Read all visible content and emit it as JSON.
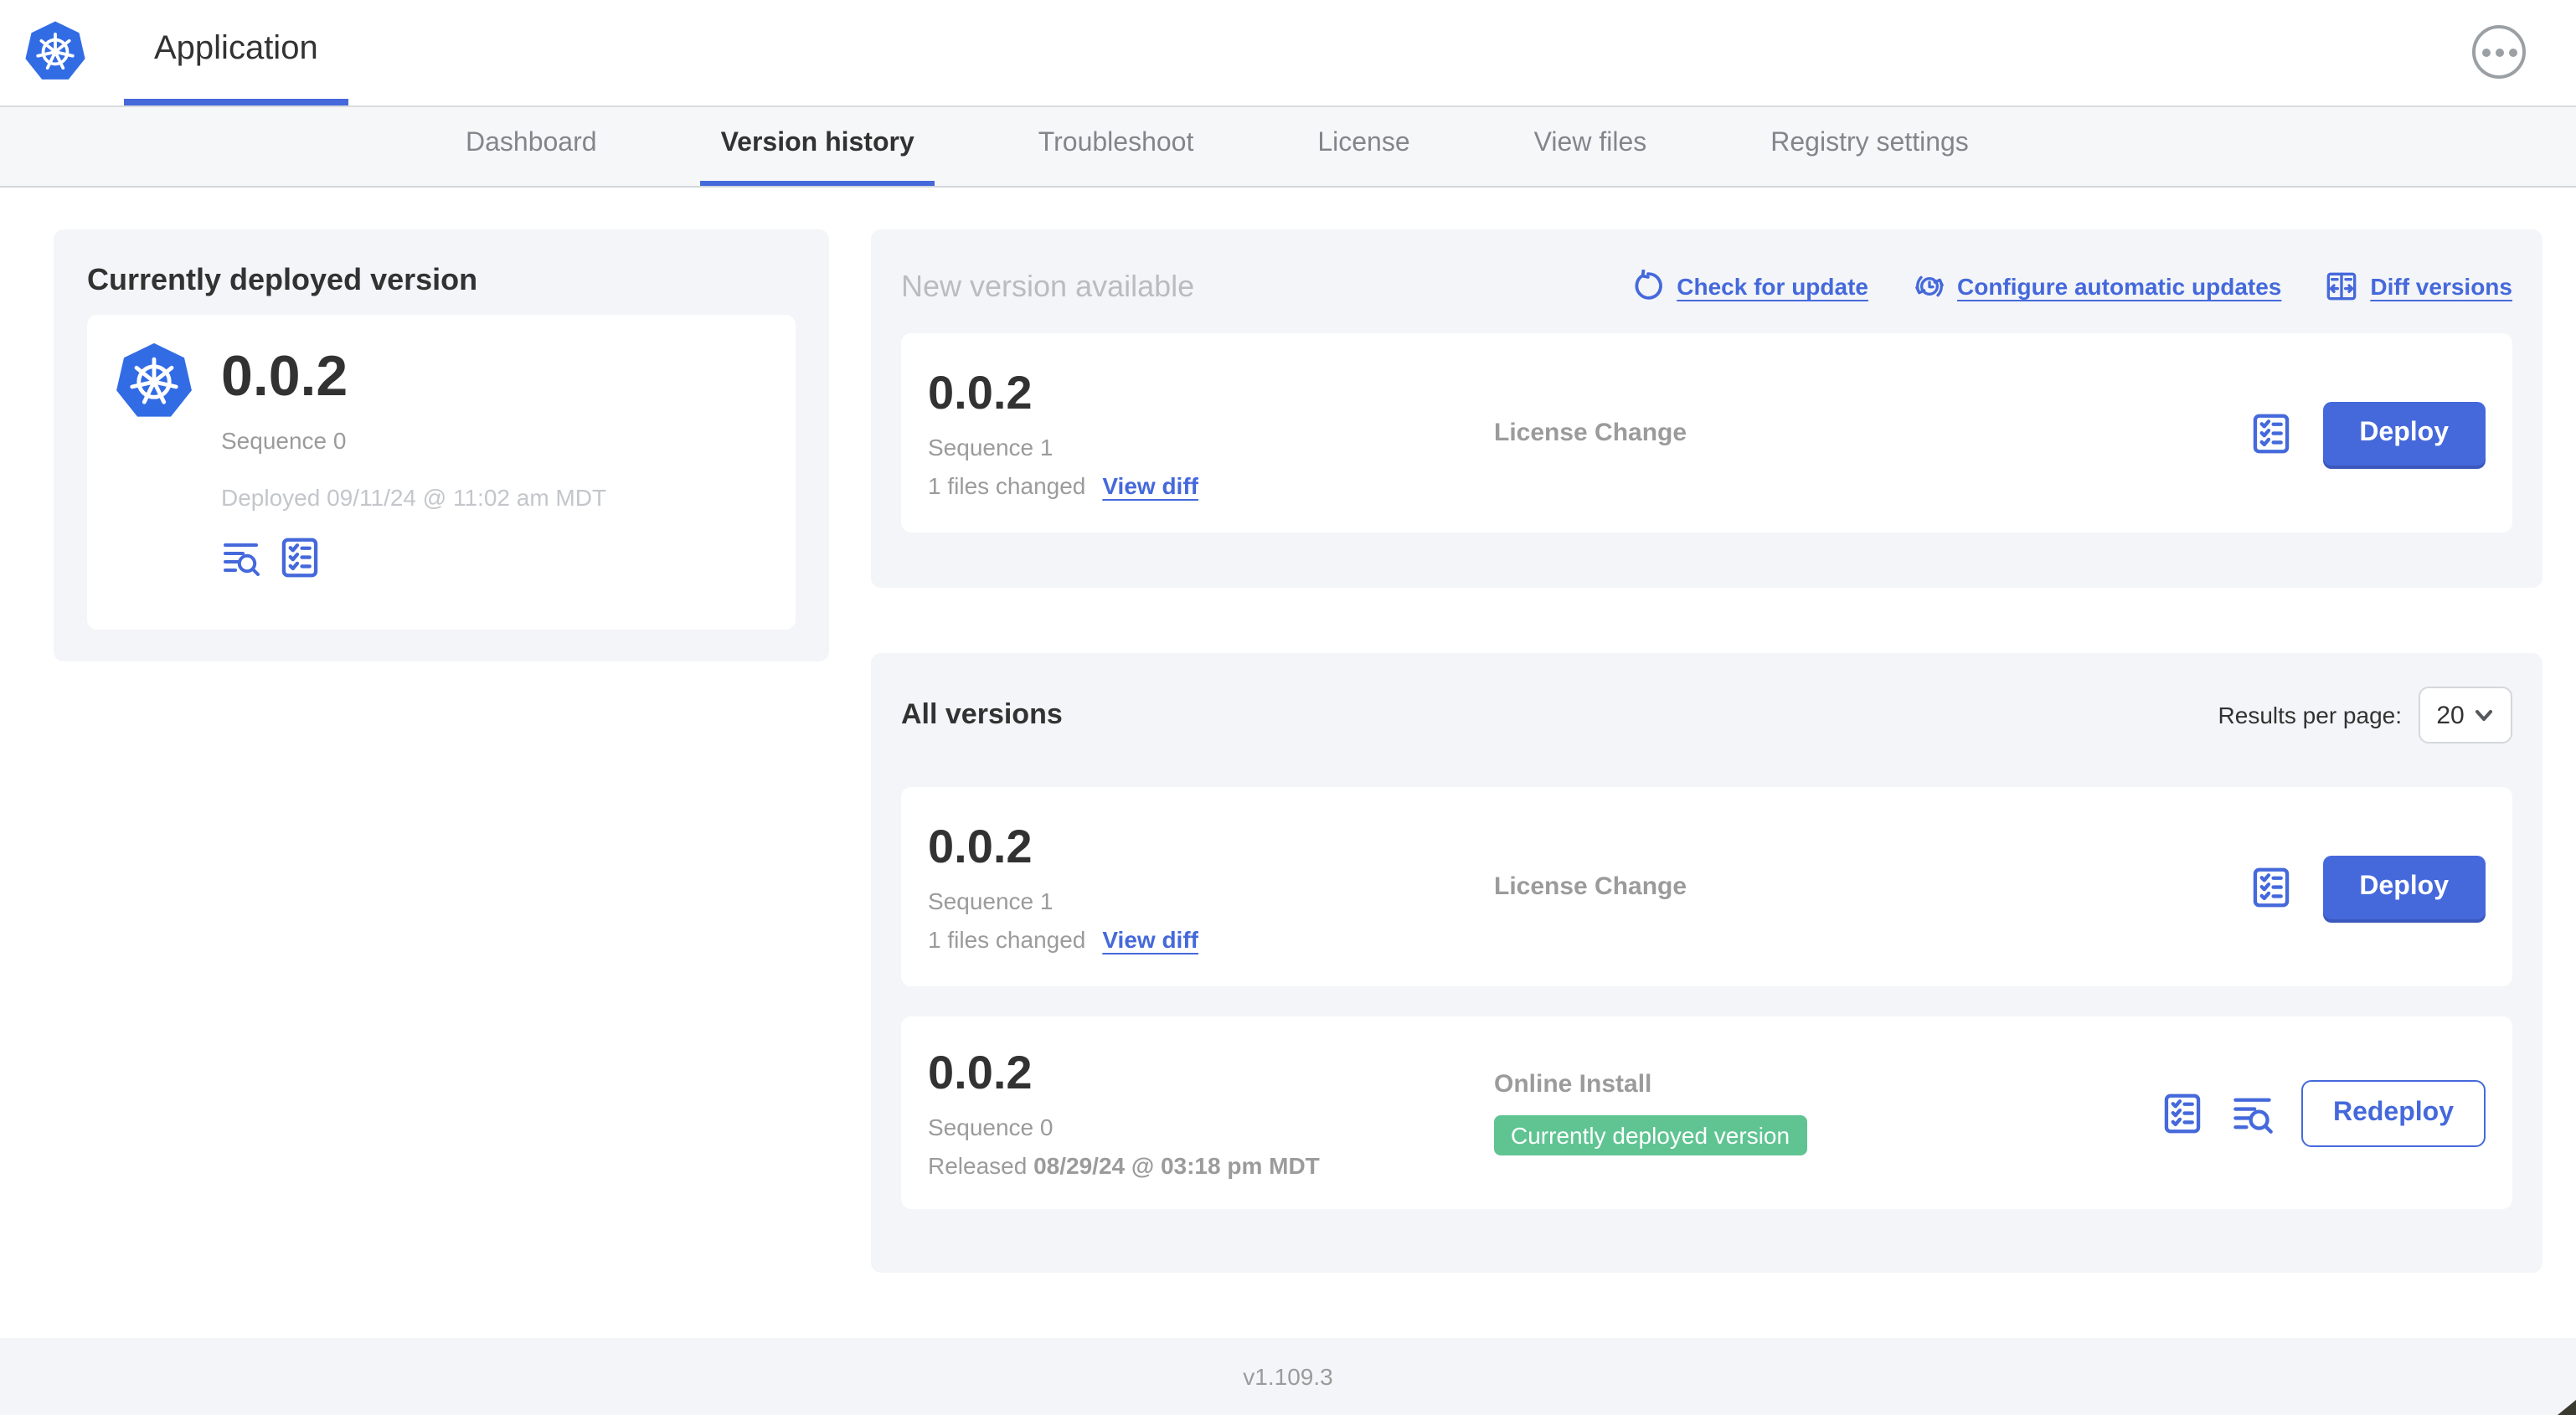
{
  "header": {
    "app_tab_label": "Application"
  },
  "nav": {
    "tabs": [
      {
        "label": "Dashboard"
      },
      {
        "label": "Version history"
      },
      {
        "label": "Troubleshoot"
      },
      {
        "label": "License"
      },
      {
        "label": "View files"
      },
      {
        "label": "Registry settings"
      }
    ],
    "active_tab": "Version history"
  },
  "currently_deployed": {
    "title": "Currently deployed version",
    "version": "0.0.2",
    "sequence": "Sequence 0",
    "deployed_timestamp": "Deployed 09/11/24 @ 11:02 am MDT"
  },
  "new_version": {
    "title": "New version available",
    "actions": {
      "check_for_update": "Check for update",
      "configure_automatic_updates": "Configure automatic updates",
      "diff_versions": "Diff versions"
    },
    "row": {
      "version": "0.0.2",
      "sequence": "Sequence 1",
      "files_changed": "1 files changed",
      "view_diff": "View diff",
      "source": "License Change",
      "action_label": "Deploy"
    }
  },
  "all_versions": {
    "title": "All versions",
    "results_per_page_label": "Results per page:",
    "results_per_page_value": "20",
    "rows": [
      {
        "version": "0.0.2",
        "sequence": "Sequence 1",
        "files_changed": "1 files changed",
        "view_diff": "View diff",
        "source": "License Change",
        "action_label": "Deploy"
      },
      {
        "version": "0.0.2",
        "sequence": "Sequence 0",
        "released_prefix": "Released",
        "released_date": "08/29/24 @ 03:18 pm MDT",
        "source": "Online Install",
        "badge": "Currently deployed version",
        "action_label": "Redeploy"
      }
    ]
  },
  "footer": {
    "app_version": "v1.109.3"
  },
  "colors": {
    "accent_blue": "#4569db",
    "kubernetes_blue": "#326ce5",
    "badge_green": "#5fc492",
    "card_background": "#f4f5f8",
    "dark_text": "#323232",
    "gray_text": "#9b9b9b",
    "light_gray_text": "#c3c6ca"
  }
}
